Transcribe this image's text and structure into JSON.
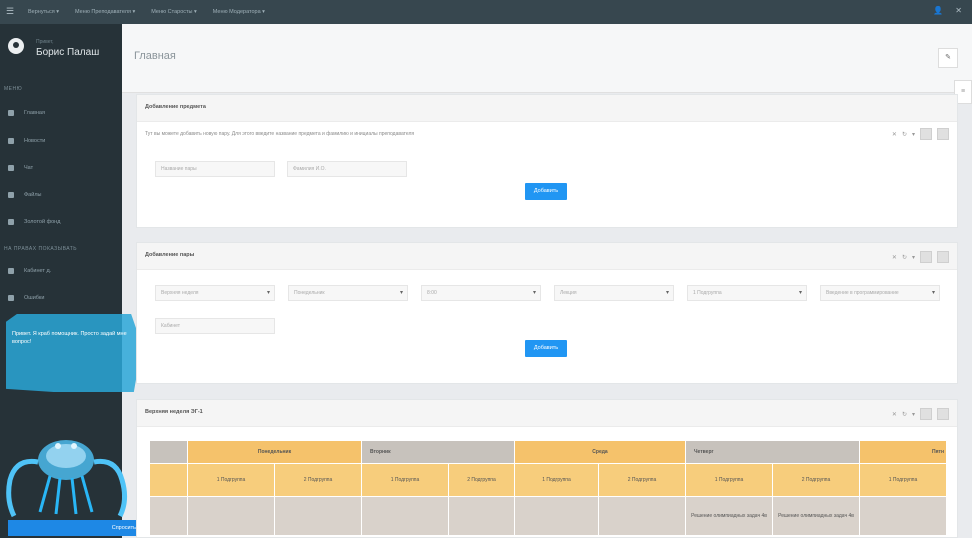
{
  "topbar": {
    "menu": [
      "Вернуться ▾",
      "Меню Преподавателя ▾",
      "Меню Старосты ▾",
      "Меню Модератора ▾"
    ]
  },
  "sidebar": {
    "brand_sub": "Привет,",
    "brand_name": "Борис Палаш",
    "section1": "МЕНЮ",
    "items": [
      {
        "label": "Главная",
        "icon": "home-icon"
      },
      {
        "label": "Новости",
        "icon": "news-icon"
      },
      {
        "label": "Чат",
        "icon": "chat-icon"
      },
      {
        "label": "Файлы",
        "icon": "files-icon"
      },
      {
        "label": "Золотой фонд",
        "icon": "star-icon"
      }
    ],
    "section2": "НА ПРАВАХ ПОКАЗЫВАТЬ",
    "items2": [
      {
        "label": "Кабинет д.",
        "icon": "user-icon"
      },
      {
        "label": "Ошибки",
        "icon": "bug-icon"
      }
    ]
  },
  "assistant": {
    "text": "Привет. Я краб помощник. Просто задай мне вопрос!",
    "send_label": "Спросить"
  },
  "page": {
    "title": "Главная"
  },
  "panel_subject": {
    "title": "Добавление предмета",
    "description": "Тут вы можете добавить новую пару. Для этого введите название предмета и фамилию и инициалы преподавателя",
    "name_placeholder": "Название пары",
    "teacher_placeholder": "Фамилия И.О.",
    "add_label": "Добавить"
  },
  "panel_pair": {
    "title": "Добавление пары",
    "selects": [
      "Верхняя неделя",
      "Понедельник",
      "8:00",
      "Лекция",
      "1 Подгруппа",
      "Введение в программирование"
    ],
    "room_placeholder": "Кабинет",
    "add_label": "Добавить"
  },
  "panel_schedule": {
    "title": "Верхняя неделя ЭГ-1",
    "days": [
      "Понедельник",
      "Вторник",
      "Среда",
      "Четверг",
      "Пятн"
    ],
    "subgroups": [
      "1 Подгруппа",
      "2 Подгруппа",
      "1 Подгруппа",
      "2 Подгруппа",
      "1 Подгруппа",
      "2 Подгруппа",
      "1 Подгруппа",
      "2 Подгруппа",
      "1 Подгруппа"
    ],
    "lessons": [
      "",
      "",
      "",
      "",
      "",
      "",
      "Решение олимпиадных задач 4в",
      "Решение олимпиадных задач 4в",
      ""
    ]
  }
}
